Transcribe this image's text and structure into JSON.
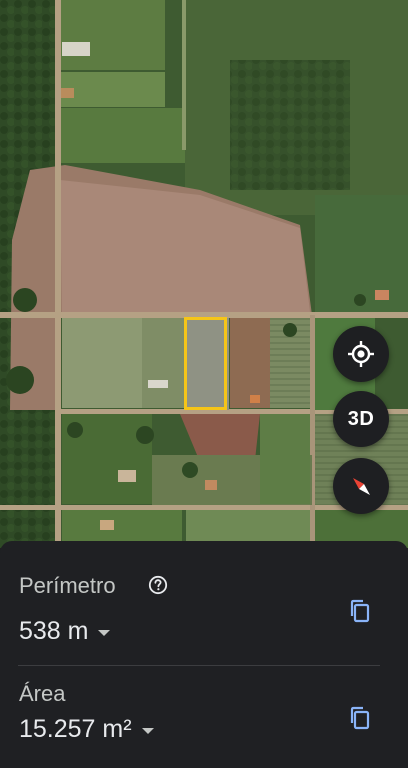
{
  "map": {
    "locate_icon": "my-location-icon",
    "mode_3d_label": "3D",
    "compass_icon": "compass-icon"
  },
  "measure": {
    "perimeter": {
      "label": "Perímetro",
      "value": "538 m",
      "help_icon": "help-circle-icon",
      "copy_icon": "copy-icon"
    },
    "area": {
      "label": "Área",
      "value": "15.257 m²",
      "copy_icon": "copy-icon"
    }
  },
  "colors": {
    "panel_bg": "#1f2023",
    "label_text": "#c4c7c5",
    "value_text": "#e8eaed",
    "accent_blue": "#8ab4f8",
    "selection_outline": "#f5c518"
  }
}
